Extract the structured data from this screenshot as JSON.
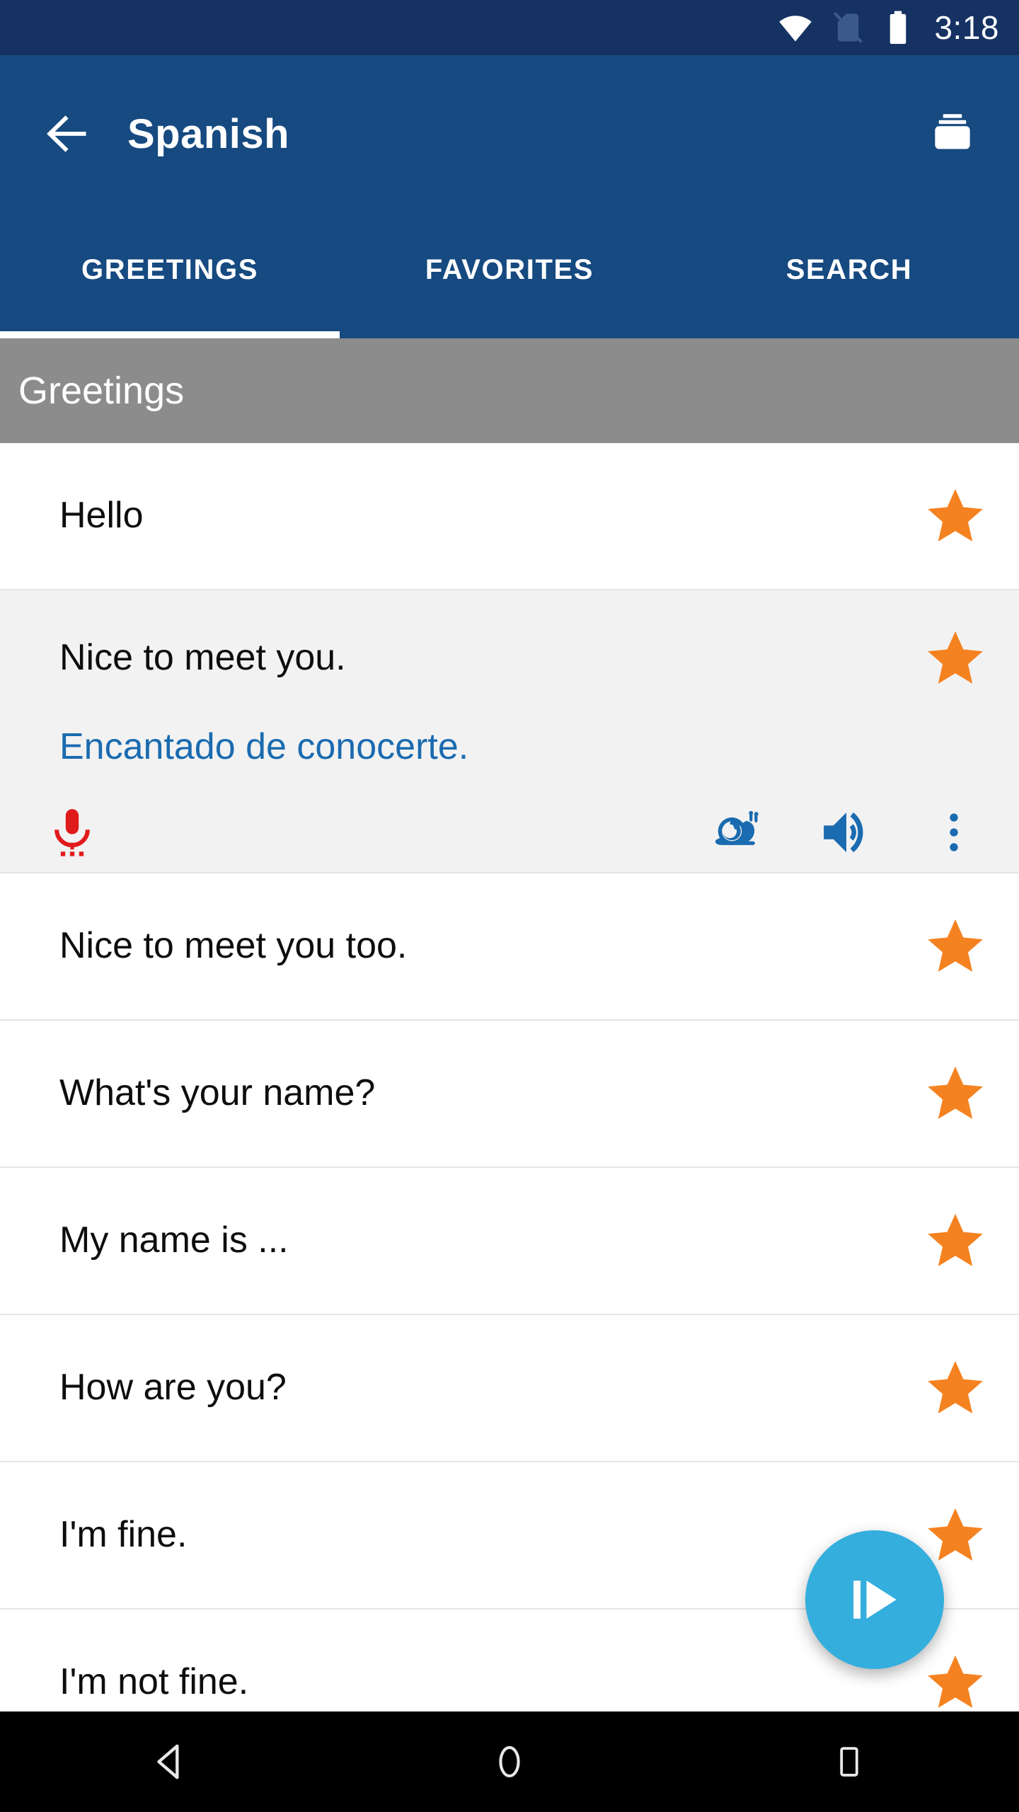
{
  "status_bar": {
    "time": "3:18",
    "icons": [
      "wifi-icon",
      "no-sim-icon",
      "battery-icon"
    ],
    "background_color": "#153263"
  },
  "app_bar": {
    "back_label": "back-arrow-icon",
    "title": "Spanish",
    "action_icon": "flashcards-stack-icon",
    "background_color": "#164a80"
  },
  "tabs": {
    "items": [
      {
        "label": "GREETINGS",
        "active": true
      },
      {
        "label": "FAVORITES",
        "active": false
      },
      {
        "label": "SEARCH",
        "active": false
      }
    ],
    "indicator_color": "#ffffff"
  },
  "section": {
    "header": "Greetings",
    "header_background": "#8c8c8c"
  },
  "list": {
    "star_color": "#f58220",
    "expanded_background": "#f2f2f2",
    "translation_color": "#1a6bb0",
    "items": [
      {
        "text": "Hello",
        "starred": true,
        "expanded": false
      },
      {
        "text": "Nice to meet you.",
        "starred": true,
        "expanded": true,
        "translation": "Encantado de conocerte.",
        "actions": {
          "record": "microphone-icon",
          "slow_audio": "snail-icon",
          "play_audio": "speaker-icon",
          "overflow": "more-vertical-icon"
        }
      },
      {
        "text": "Nice to meet you too.",
        "starred": true,
        "expanded": false
      },
      {
        "text": "What's your name?",
        "starred": true,
        "expanded": false
      },
      {
        "text": "My name is ...",
        "starred": true,
        "expanded": false
      },
      {
        "text": "How are you?",
        "starred": true,
        "expanded": false
      },
      {
        "text": "I'm fine.",
        "starred": true,
        "expanded": false
      },
      {
        "text": "I'm not fine.",
        "starred": true,
        "expanded": false
      }
    ]
  },
  "fab": {
    "icon": "play-from-start-icon",
    "color": "#34aedd"
  },
  "nav_bar": {
    "buttons": [
      "back-triangle-icon",
      "home-circle-icon",
      "recents-square-icon"
    ],
    "background_color": "#000000"
  }
}
